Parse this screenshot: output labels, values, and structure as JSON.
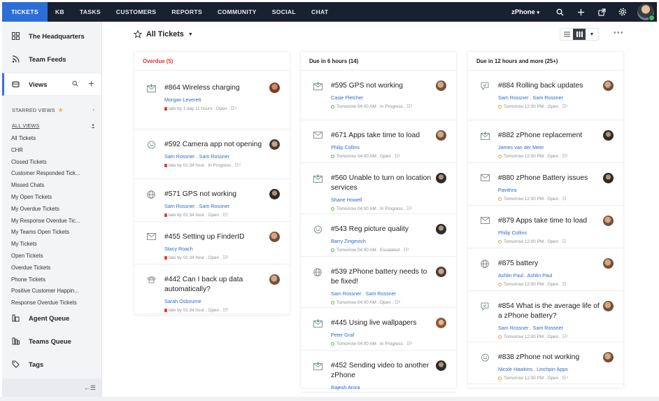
{
  "nav": {
    "items": [
      "TICKETS",
      "KB",
      "TASKS",
      "CUSTOMERS",
      "REPORTS",
      "COMMUNITY",
      "SOCIAL",
      "CHAT"
    ],
    "brand": "zPhone",
    "brand_caret": "▾"
  },
  "sidebar": {
    "headquarters": "The Headquarters",
    "team_feeds": "Team Feeds",
    "views": "Views",
    "starred_views": "STARRED VIEWS",
    "all_views": "ALL VIEWS",
    "view_list": [
      "All Tickets",
      "CHR",
      "Closed Tickets",
      "Customer Responded Tick...",
      "Missed Chats",
      "My Open Tickets",
      "My Overdue Tickets",
      "My Response Overdue Tic...",
      "My Teams Open Tickets",
      "My Tickets",
      "Open Tickets",
      "Overdue Tickets",
      "Phone Tickets",
      "Positive Customer Happin...",
      "Response Overdue Tickets"
    ],
    "agent_queue": "Agent Queue",
    "teams_queue": "Teams Queue",
    "tags": "Tags",
    "collapse": "←☰"
  },
  "main": {
    "title": "All Tickets",
    "more": "•••"
  },
  "columns": [
    {
      "title": "Overdue (5)",
      "cards": [
        {
          "title": "#864 Wireless charging",
          "people": "Morgan Leverett",
          "meta": "late by 1 day 11 hours  .  Open  .  ☷⁴",
          "status": "late",
          "icon": "mail-in-icon"
        },
        {
          "title": "#592 Camera app not opening",
          "people": "Sam Rossner  .  Sam Rossner",
          "meta": "late by 01:34 hour  .  In Progress  .  ☷⁹",
          "status": "late",
          "icon": "chat-icon"
        },
        {
          "title": "#571 GPS not working",
          "people": "Sam Rossner  .  Sam Rossner",
          "meta": "late by 01:34 hour  .  Open  .  ☷¹",
          "status": "late",
          "icon": "globe-icon"
        },
        {
          "title": "#455 Setting up FinderID",
          "people": "Stacy Roach",
          "meta": "late by 01:34 hour  .  Open  .  ☷²",
          "status": "late",
          "icon": "mail-icon"
        },
        {
          "title": "#442 Can I back up data automatically?",
          "people": "Sarah Osbourne",
          "meta": "late by 01:34 hour  .  Open  .  ☷²",
          "status": "late",
          "icon": "phone-icon"
        }
      ]
    },
    {
      "title": "Due in 6 hours (14)",
      "cards": [
        {
          "title": "#595 GPS not working",
          "people": "Casie Fletcher",
          "meta": "Tomorrow 04:00 AM  .  In Progress  .  ☷³",
          "status": "ok",
          "icon": "mail-in-icon"
        },
        {
          "title": "#671 Apps take time to load",
          "people": "Philip Collins",
          "meta": "Tomorrow 04:00 AM  .  Open  .  ☷¹",
          "status": "ok",
          "icon": "mail-icon"
        },
        {
          "title": "#560 Unable to turn on location services",
          "people": "Shane Howell",
          "meta": "Tomorrow 04:00 AM  .  In Progress  .  ☷³",
          "status": "ok",
          "icon": "mail-in-icon"
        },
        {
          "title": "#543 Reg picture quality",
          "people": "Barry Zingevich",
          "meta": "Tomorrow 04:00 AM  .  Escalated  .  ☷³",
          "status": "ok",
          "icon": "chat-icon"
        },
        {
          "title": "#539 zPhone battery needs to be fixed!",
          "people": "Sam Rossner  .  Sam Rossner",
          "meta": "Tomorrow 04:00 AM  .  Open  .  ☷⁶",
          "status": "ok",
          "icon": "globe-icon"
        },
        {
          "title": "#445 Using live wallpapers",
          "people": "Peter Graf",
          "meta": "Tomorrow 04:00 AM  .  In Progress  .  ☷³",
          "status": "ok",
          "icon": "mail-in-icon"
        },
        {
          "title": "#452 Sending video to another zPhone",
          "people": "Rajesh Arora",
          "meta": "",
          "status": "ok",
          "icon": "mail-in-icon"
        }
      ]
    },
    {
      "title": "Due in 12 hours and more (25+)",
      "cards": [
        {
          "title": "#884 Rolling back updates",
          "people": "Sam Rossner  .  Sam Rossner",
          "meta": "Tomorrow 12:00 PM  .  Open  .  ☷¹",
          "status": "later",
          "icon": "feedback-icon"
        },
        {
          "title": "#882 zPhone replacement",
          "people": "James van der Meer",
          "meta": "Tomorrow 12:00 PM  .  Open  .  ☷²",
          "status": "later",
          "icon": "mail-in-icon"
        },
        {
          "title": "#880 zPhone Battery issues",
          "people": "Pavithra",
          "meta": "Tomorrow 12:00 PM  .  Open  .  ☷",
          "status": "later",
          "icon": "mail-icon"
        },
        {
          "title": "#879 Apps take time to load",
          "people": "Philip Collins",
          "meta": "Tomorrow 12:00 PM  .  Open  .  ☷",
          "status": "later",
          "icon": "mail-icon"
        },
        {
          "title": "#875 battery",
          "people": "Ashlin Paul  .  Ashlin Paul",
          "meta": "Tomorrow 12:00 PM  .  Open  .  ☷",
          "status": "later",
          "icon": "globe-icon"
        },
        {
          "title": "#854 What is the average life of a zPhone battery?",
          "people": "Sam Rossner  .  Sam Rossner",
          "meta": "Tomorrow 12:00 PM  .  Open  .  ☷²",
          "status": "later",
          "icon": "feedback-icon"
        },
        {
          "title": "#838 zPhone not working",
          "people": "Nicole Hawkins  .  Linchpin Apps",
          "meta": "Tomorrow 12:00 PM  .  Open  .  ☷⁴",
          "status": "later",
          "icon": "chat-icon"
        }
      ]
    }
  ]
}
